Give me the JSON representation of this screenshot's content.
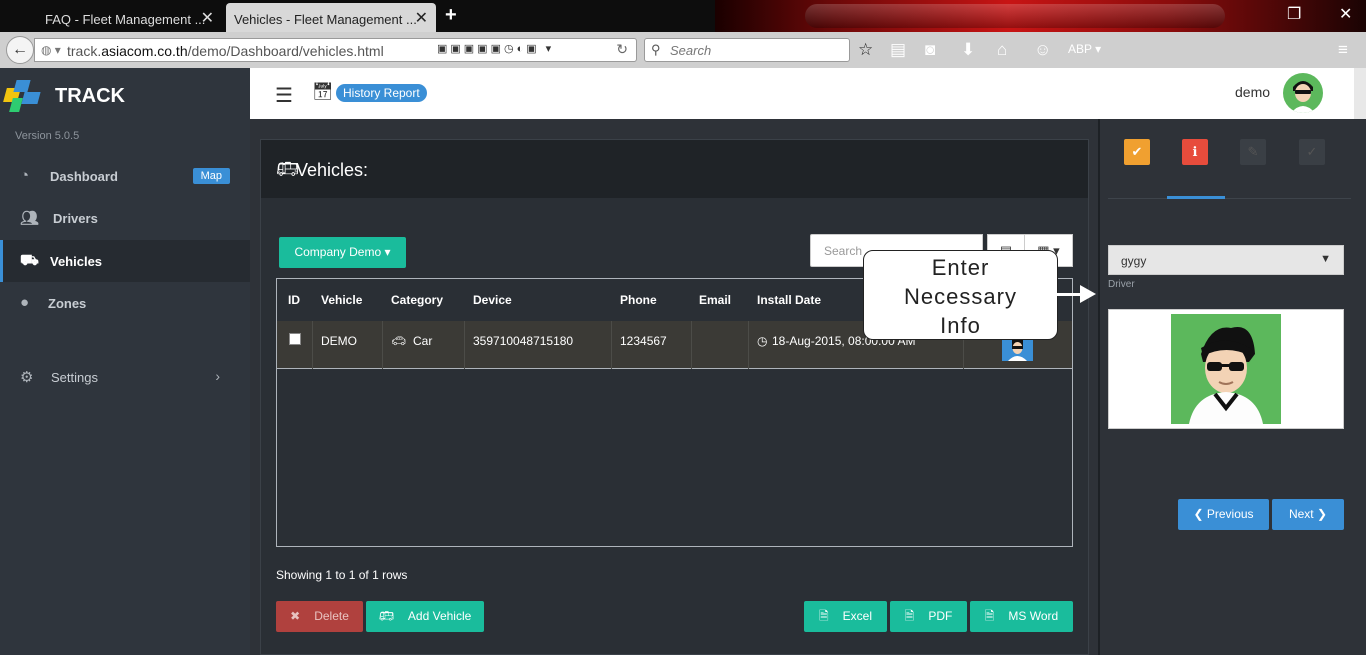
{
  "browser": {
    "tabs": [
      {
        "title": "FAQ - Fleet Management ..."
      },
      {
        "title": "Vehicles - Fleet Management ..."
      }
    ],
    "url_prefix": "track.",
    "url_domain": "asiacom.co.th",
    "url_path": "/demo/Dashboard/vehicles.html",
    "search_placeholder": "Search"
  },
  "app": {
    "brand": "TRACK",
    "version": "Version 5.0.5",
    "history_report": "History Report",
    "username": "demo",
    "accent_color": "#3a8fd6"
  },
  "sidebar": {
    "items": [
      {
        "label": "Dashboard",
        "icon": "dashboard-icon",
        "badge": "Map"
      },
      {
        "label": "Drivers",
        "icon": "users-icon"
      },
      {
        "label": "Vehicles",
        "icon": "truck-icon"
      },
      {
        "label": "Zones",
        "icon": "globe-icon"
      },
      {
        "label": "Settings",
        "icon": "gears-icon"
      }
    ]
  },
  "panel": {
    "title": "Vehicles:",
    "company_dropdown": "Company Demo",
    "search_placeholder": "Search"
  },
  "table": {
    "columns": [
      "ID",
      "Vehicle",
      "Category",
      "Device",
      "Phone",
      "Email",
      "Install Date"
    ],
    "rows": [
      {
        "vehicle": "DEMO",
        "category": "Car",
        "device": "359710048715180",
        "phone": "1234567",
        "email": "",
        "install_date": "18-Aug-2015, 08:00:00 AM"
      }
    ],
    "showing": "Showing 1 to 1 of 1 rows"
  },
  "actions": {
    "delete": "Delete",
    "add": "Add Vehicle",
    "excel": "Excel",
    "pdf": "PDF",
    "word": "MS Word"
  },
  "callout": {
    "line1": "Enter",
    "line2": "Necessary",
    "line3": "Info"
  },
  "wizard": {
    "driver_value": "gygy",
    "driver_label": "Driver",
    "previous": "Previous",
    "next": "Next"
  }
}
